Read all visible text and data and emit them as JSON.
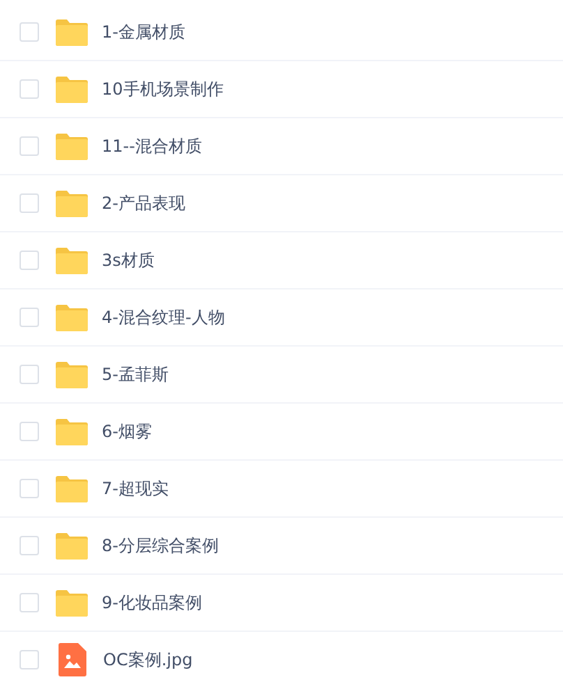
{
  "files": [
    {
      "name": "1-金属材质",
      "kind": "folder",
      "checked": false
    },
    {
      "name": "10手机场景制作",
      "kind": "folder",
      "checked": false
    },
    {
      "name": "11--混合材质",
      "kind": "folder",
      "checked": false
    },
    {
      "name": "2-产品表现",
      "kind": "folder",
      "checked": false
    },
    {
      "name": "3s材质",
      "kind": "folder",
      "checked": false
    },
    {
      "name": "4-混合纹理-人物",
      "kind": "folder",
      "checked": false
    },
    {
      "name": "5-孟菲斯",
      "kind": "folder",
      "checked": false
    },
    {
      "name": "6-烟雾",
      "kind": "folder",
      "checked": false
    },
    {
      "name": "7-超现实",
      "kind": "folder",
      "checked": false
    },
    {
      "name": "8-分层综合案例",
      "kind": "folder",
      "checked": false
    },
    {
      "name": "9-化妆品案例",
      "kind": "folder",
      "checked": false
    },
    {
      "name": "OC案例.jpg",
      "kind": "image",
      "checked": false
    }
  ]
}
